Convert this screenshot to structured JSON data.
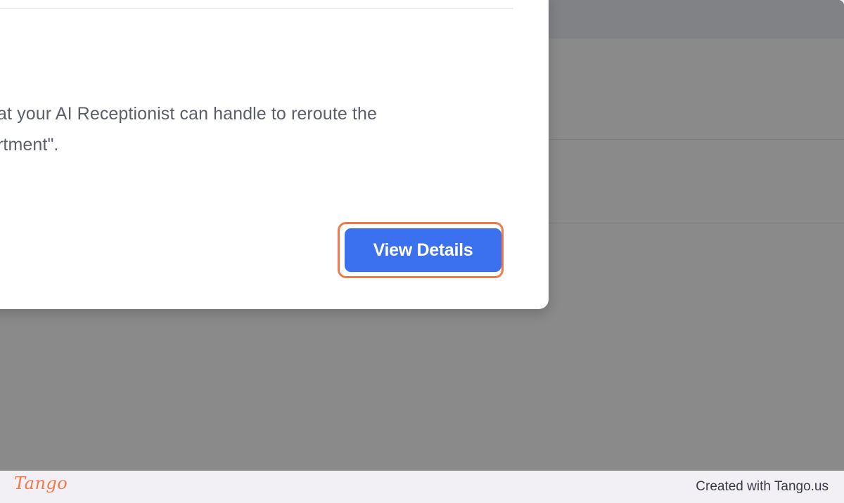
{
  "modal": {
    "description_line1": "hat your AI Receptionist can handle to reroute the",
    "description_line2": "artment\".",
    "view_details_label": "View Details"
  },
  "footer": {
    "logo_text": "Tango",
    "credit_text": "Created with Tango.us"
  },
  "colors": {
    "primary_button": "#3b71ee",
    "highlight": "#f0794b",
    "overlay": "#8a8a8a",
    "brand": "#f07a4a"
  }
}
